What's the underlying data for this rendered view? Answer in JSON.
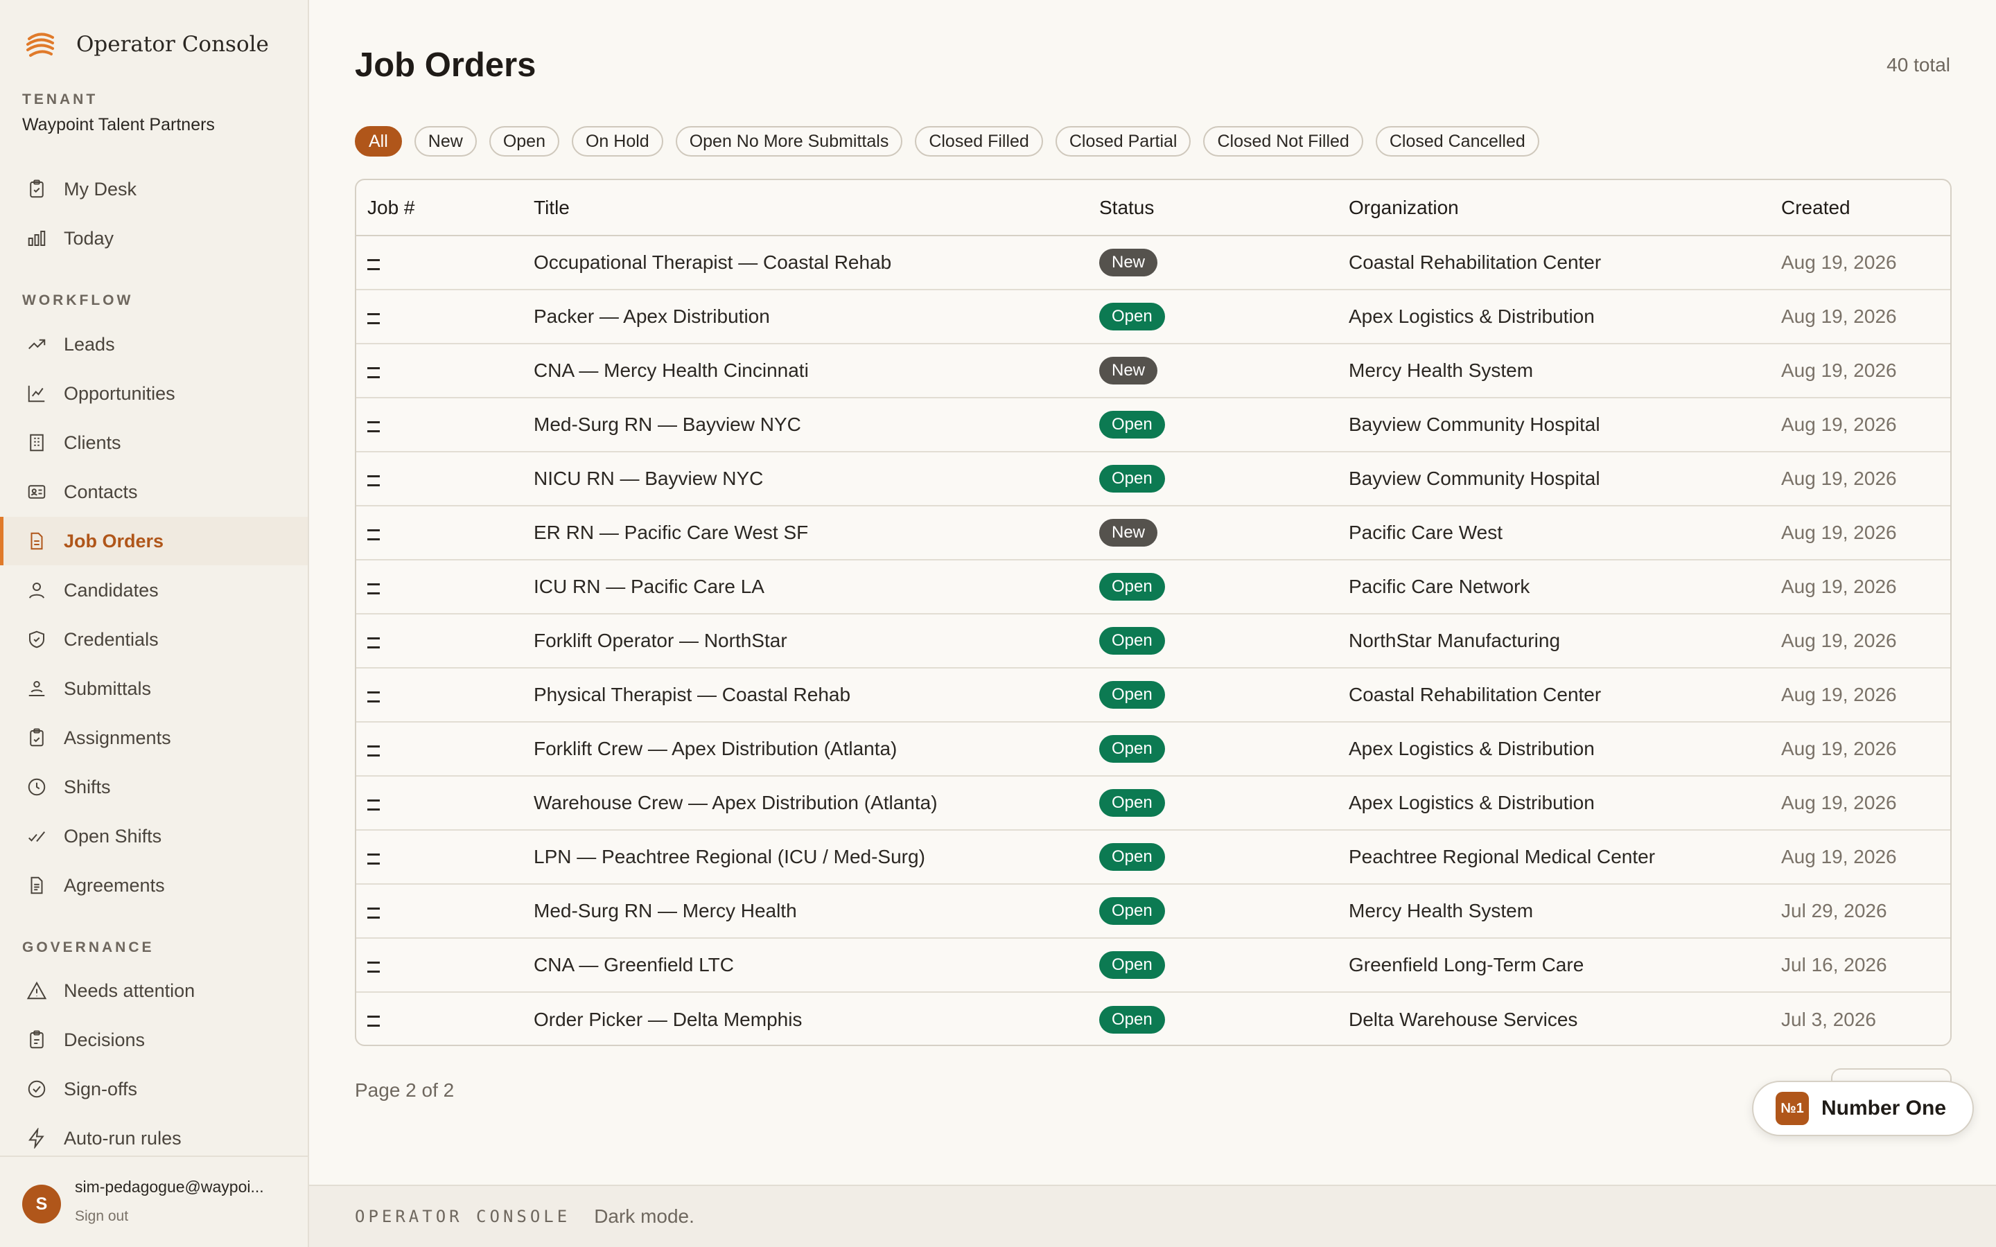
{
  "app": {
    "name": "Operator Console"
  },
  "tenant": {
    "label": "TENANT",
    "name": "Waypoint Talent Partners"
  },
  "nav": {
    "top": [
      {
        "label": "My Desk",
        "icon": "clipboard-icon"
      },
      {
        "label": "Today",
        "icon": "bar-chart-icon"
      }
    ],
    "workflow_label": "WORKFLOW",
    "workflow": [
      {
        "label": "Leads",
        "icon": "trending-up-icon"
      },
      {
        "label": "Opportunities",
        "icon": "line-chart-icon"
      },
      {
        "label": "Clients",
        "icon": "building-icon"
      },
      {
        "label": "Contacts",
        "icon": "contact-card-icon"
      },
      {
        "label": "Job Orders",
        "icon": "document-icon",
        "active": true
      },
      {
        "label": "Candidates",
        "icon": "user-icon"
      },
      {
        "label": "Credentials",
        "icon": "shield-check-icon"
      },
      {
        "label": "Submittals",
        "icon": "user-stand-icon"
      },
      {
        "label": "Assignments",
        "icon": "clipboard-check-icon"
      },
      {
        "label": "Shifts",
        "icon": "clock-icon"
      },
      {
        "label": "Open Shifts",
        "icon": "check-slash-icon"
      },
      {
        "label": "Agreements",
        "icon": "file-text-icon"
      }
    ],
    "governance_label": "GOVERNANCE",
    "governance": [
      {
        "label": "Needs attention",
        "icon": "warning-icon"
      },
      {
        "label": "Decisions",
        "icon": "clipboard-list-icon"
      },
      {
        "label": "Sign-offs",
        "icon": "circle-check-icon"
      },
      {
        "label": "Auto-run rules",
        "icon": "lightning-icon"
      }
    ]
  },
  "user": {
    "initial": "S",
    "email": "sim-pedagogue@waypoi...",
    "signout": "Sign out"
  },
  "page": {
    "title": "Job Orders",
    "total": "40 total"
  },
  "filters": [
    {
      "label": "All",
      "active": true
    },
    {
      "label": "New"
    },
    {
      "label": "Open"
    },
    {
      "label": "On Hold"
    },
    {
      "label": "Open No More Submittals"
    },
    {
      "label": "Closed Filled"
    },
    {
      "label": "Closed Partial"
    },
    {
      "label": "Closed Not Filled"
    },
    {
      "label": "Closed Cancelled"
    }
  ],
  "table": {
    "columns": [
      "Job #",
      "Title",
      "Status",
      "Organization",
      "Created"
    ],
    "rows": [
      {
        "job": "",
        "title": "Occupational Therapist — Coastal Rehab",
        "status": "New",
        "org": "Coastal Rehabilitation Center",
        "created": "Aug 19, 2026"
      },
      {
        "job": "",
        "title": "Packer — Apex Distribution",
        "status": "Open",
        "org": "Apex Logistics & Distribution",
        "created": "Aug 19, 2026"
      },
      {
        "job": "",
        "title": "CNA — Mercy Health Cincinnati",
        "status": "New",
        "org": "Mercy Health System",
        "created": "Aug 19, 2026"
      },
      {
        "job": "",
        "title": "Med-Surg RN — Bayview NYC",
        "status": "Open",
        "org": "Bayview Community Hospital",
        "created": "Aug 19, 2026"
      },
      {
        "job": "",
        "title": "NICU RN — Bayview NYC",
        "status": "Open",
        "org": "Bayview Community Hospital",
        "created": "Aug 19, 2026"
      },
      {
        "job": "",
        "title": "ER RN — Pacific Care West SF",
        "status": "New",
        "org": "Pacific Care West",
        "created": "Aug 19, 2026"
      },
      {
        "job": "",
        "title": "ICU RN — Pacific Care LA",
        "status": "Open",
        "org": "Pacific Care Network",
        "created": "Aug 19, 2026"
      },
      {
        "job": "",
        "title": "Forklift Operator — NorthStar",
        "status": "Open",
        "org": "NorthStar Manufacturing",
        "created": "Aug 19, 2026"
      },
      {
        "job": "",
        "title": "Physical Therapist — Coastal Rehab",
        "status": "Open",
        "org": "Coastal Rehabilitation Center",
        "created": "Aug 19, 2026"
      },
      {
        "job": "",
        "title": "Forklift Crew — Apex Distribution (Atlanta)",
        "status": "Open",
        "org": "Apex Logistics & Distribution",
        "created": "Aug 19, 2026"
      },
      {
        "job": "",
        "title": "Warehouse Crew — Apex Distribution (Atlanta)",
        "status": "Open",
        "org": "Apex Logistics & Distribution",
        "created": "Aug 19, 2026"
      },
      {
        "job": "",
        "title": "LPN — Peachtree Regional (ICU / Med-Surg)",
        "status": "Open",
        "org": "Peachtree Regional Medical Center",
        "created": "Aug 19, 2026"
      },
      {
        "job": "",
        "title": "Med-Surg RN — Mercy Health",
        "status": "Open",
        "org": "Mercy Health System",
        "created": "Jul 29, 2026"
      },
      {
        "job": "",
        "title": "CNA — Greenfield LTC",
        "status": "Open",
        "org": "Greenfield Long-Term Care",
        "created": "Jul 16, 2026"
      },
      {
        "job": "",
        "title": "Order Picker — Delta Memphis",
        "status": "Open",
        "org": "Delta Warehouse Services",
        "created": "Jul 3, 2026"
      }
    ]
  },
  "pager": {
    "text": "Page 2 of 2"
  },
  "assistant": {
    "logo_text": "№1",
    "label": "Number One"
  },
  "footer": {
    "brand": "OPERATOR CONSOLE",
    "text": "Dark mode."
  },
  "colors": {
    "accent": "#b0561a",
    "status_open": "#0c7a52",
    "status_new": "#55524d",
    "background": "#faf8f3",
    "sidebar": "#f4f1ea"
  }
}
